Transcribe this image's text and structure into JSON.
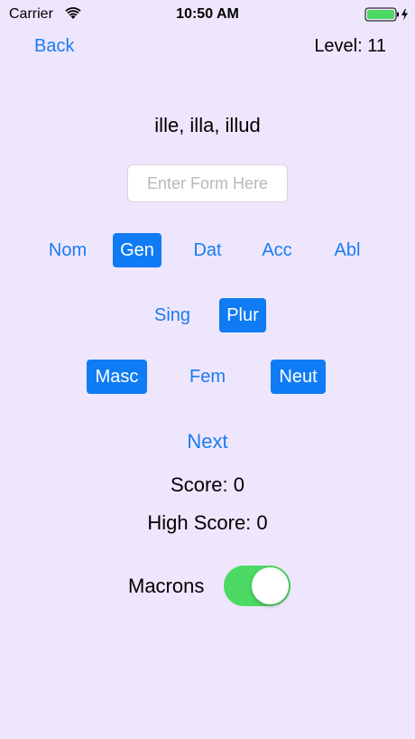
{
  "status_bar": {
    "carrier": "Carrier",
    "time": "10:50 AM",
    "wifi_icon": "wifi-icon",
    "battery_icon": "battery-icon",
    "battery_color": "#4CD964"
  },
  "nav": {
    "back_label": "Back",
    "level_label": "Level: 11"
  },
  "word": "ille, illa, illud",
  "form_input": {
    "value": "",
    "placeholder": "Enter Form Here"
  },
  "cases": {
    "nom": "Nom",
    "gen": "Gen",
    "dat": "Dat",
    "acc": "Acc",
    "abl": "Abl",
    "selected": "Gen"
  },
  "numbers": {
    "sing": "Sing",
    "plur": "Plur",
    "selected": "Plur"
  },
  "genders": {
    "masc": "Masc",
    "fem": "Fem",
    "neut": "Neut",
    "selected": [
      "Masc",
      "Neut"
    ]
  },
  "next_label": "Next",
  "score_label": "Score: 0",
  "high_score_label": "High Score: 0",
  "macrons": {
    "label": "Macrons",
    "on": true
  },
  "colors": {
    "background": "#EEE6FD",
    "accent": "#1A7CF0",
    "selected_fill": "#0F7BF4",
    "toggle_on": "#4CD964"
  }
}
